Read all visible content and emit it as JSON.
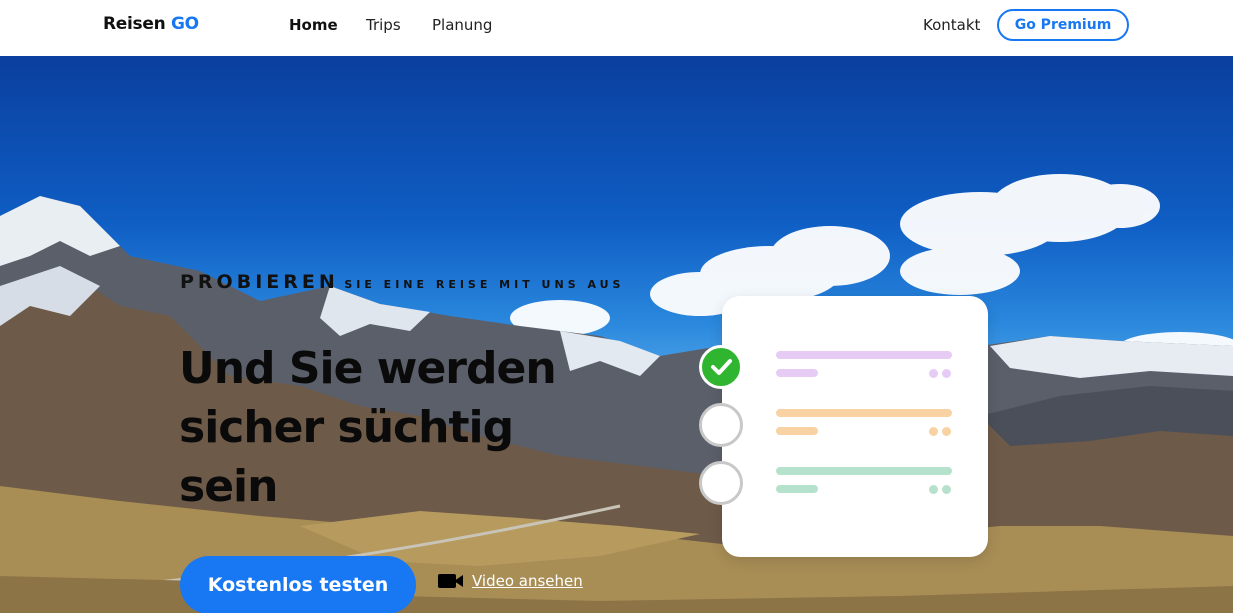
{
  "nav": {
    "brand_main": "Reisen",
    "brand_accent": "GO",
    "links": [
      {
        "label": "Home",
        "active": true
      },
      {
        "label": "Trips",
        "active": false
      },
      {
        "label": "Planung",
        "active": false
      }
    ],
    "contact": "Kontakt",
    "premium_button": "Go Premium"
  },
  "hero": {
    "kicker_big": "PROBIEREN",
    "kicker_small": "SIE EINE REISE MIT UNS AUS",
    "headline": "Und Sie werden sicher süchtig sein",
    "cta_label": "Kostenlos testen",
    "video_label": "Video ansehen"
  },
  "checklist": {
    "items": [
      {
        "state": "checked",
        "color": "#e6ccf5"
      },
      {
        "state": "unchecked",
        "color": "#f8d2a2"
      },
      {
        "state": "unchecked",
        "color": "#b6e1cc"
      }
    ]
  },
  "colors": {
    "accent": "#1877f2",
    "check_green": "#2fb52f"
  }
}
